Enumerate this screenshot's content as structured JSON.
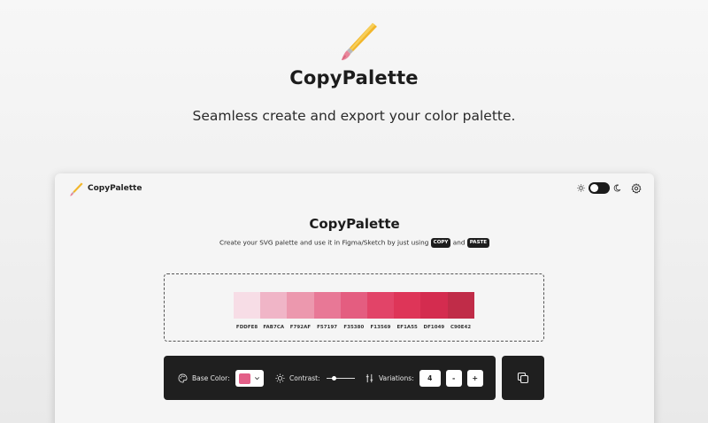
{
  "hero": {
    "title": "CopyPalette",
    "subtitle": "Seamless create and export your color palette."
  },
  "app": {
    "header_name": "CopyPalette",
    "title": "CopyPalette",
    "description_part1": "Create your SVG palette and use it in Figma/Sketch by just using",
    "copy_key": "COPY",
    "and_text": "and",
    "paste_key": "PASTE",
    "theme_mode": "dark-toggle",
    "icons": {
      "logo": "paintbrush-icon",
      "sun": "sun-icon",
      "moon": "moon-icon",
      "settings": "gear-icon",
      "base_color": "palette-icon",
      "contrast": "brightness-icon",
      "variations": "sliders-icon",
      "copy": "copy-icon"
    }
  },
  "palette": {
    "swatches": [
      {
        "hex": "FDDFE8",
        "color": "#f7dde6"
      },
      {
        "hex": "FAB7CA",
        "color": "#f0b5c7"
      },
      {
        "hex": "F792AF",
        "color": "#ec98ae"
      },
      {
        "hex": "F57197",
        "color": "#e87896"
      },
      {
        "hex": "F35380",
        "color": "#e45d80"
      },
      {
        "hex": "F13569",
        "color": "#e24468"
      },
      {
        "hex": "EF1A55",
        "color": "#de3558"
      },
      {
        "hex": "DF1049",
        "color": "#d42c4f"
      },
      {
        "hex": "C90E42",
        "color": "#c02c48"
      }
    ]
  },
  "controls": {
    "base_color_label": "Base Color:",
    "base_color_value": "#e35f88",
    "contrast_label": "Contrast:",
    "contrast_value": 0.25,
    "variations_label": "Variations:",
    "variations_value": "4",
    "minus_label": "-",
    "plus_label": "+"
  }
}
